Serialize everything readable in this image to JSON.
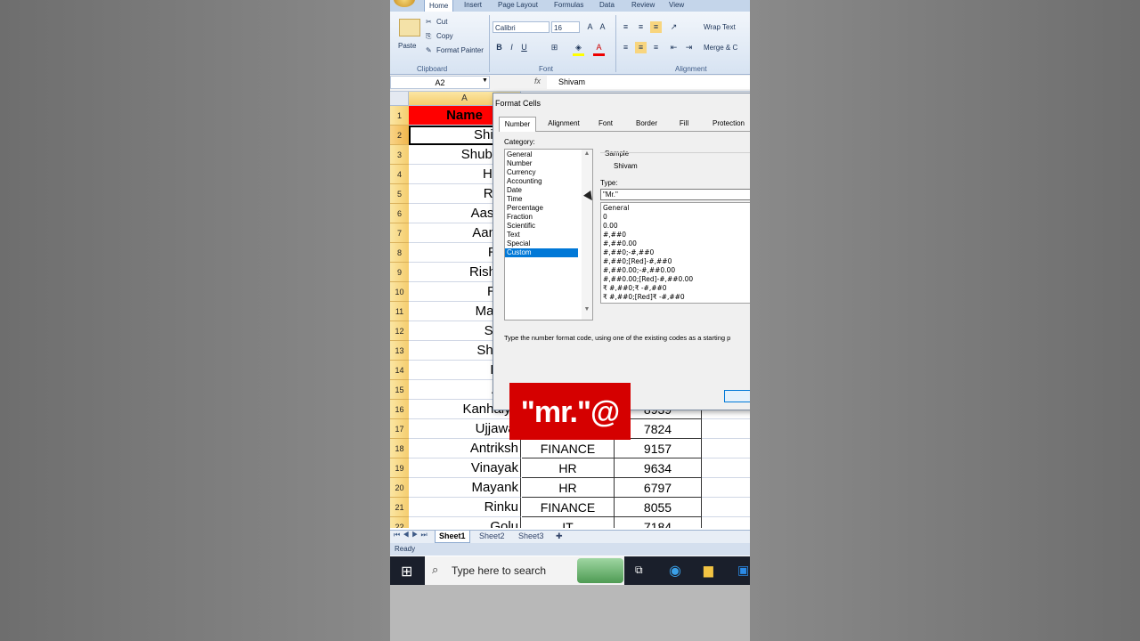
{
  "ribbon": {
    "tabs": [
      "Home",
      "Insert",
      "Page Layout",
      "Formulas",
      "Data",
      "Review",
      "View"
    ],
    "clipboard": {
      "paste": "Paste",
      "cut": "Cut",
      "copy": "Copy",
      "format_painter": "Format Painter",
      "label": "Clipboard"
    },
    "font": {
      "name": "Calibri",
      "size": "16",
      "bold": "B",
      "italic": "I",
      "underline": "U",
      "label": "Font"
    },
    "alignment": {
      "wrap_text": "Wrap Text",
      "merge": "Merge & C",
      "label": "Alignment"
    }
  },
  "formula_bar": {
    "name_box": "A2",
    "fx": "fx",
    "content": "Shivam"
  },
  "columns": [
    "A"
  ],
  "header_cell": "Name",
  "rows": [
    {
      "n": "1"
    },
    {
      "n": "2",
      "a": "Shivam"
    },
    {
      "n": "3",
      "a": "Shubham"
    },
    {
      "n": "4",
      "a": "Harsh"
    },
    {
      "n": "5",
      "a": "Rahul"
    },
    {
      "n": "6",
      "a": "Aashish"
    },
    {
      "n": "7",
      "a": "Aanand"
    },
    {
      "n": "8",
      "a": "Rahil"
    },
    {
      "n": "9",
      "a": "Rishabh"
    },
    {
      "n": "10",
      "a": "Rohit"
    },
    {
      "n": "11",
      "a": "Manish"
    },
    {
      "n": "12",
      "a": "Sumit"
    },
    {
      "n": "13",
      "a": "Shyam"
    },
    {
      "n": "14",
      "a": "Ram"
    },
    {
      "n": "15",
      "a": "Anuj"
    },
    {
      "n": "16",
      "a": "Kanhaiya",
      "b": "",
      "c": "8939"
    },
    {
      "n": "17",
      "a": "Ujjawal",
      "b": "",
      "c": "7824"
    },
    {
      "n": "18",
      "a": "Antriksh",
      "b": "FINANCE",
      "c": "9157"
    },
    {
      "n": "19",
      "a": "Vinayak",
      "b": "HR",
      "c": "9634"
    },
    {
      "n": "20",
      "a": "Mayank",
      "b": "HR",
      "c": "6797"
    },
    {
      "n": "21",
      "a": "Rinku",
      "b": "FINANCE",
      "c": "8055"
    },
    {
      "n": "22",
      "a": "Golu",
      "b": "IT",
      "c": "7184"
    }
  ],
  "sheets": [
    "Sheet1",
    "Sheet2",
    "Sheet3"
  ],
  "status": "Ready",
  "taskbar": {
    "search_placeholder": "Type here to search"
  },
  "dialog": {
    "title": "Format Cells",
    "tabs": [
      "Number",
      "Alignment",
      "Font",
      "Border",
      "Fill",
      "Protection"
    ],
    "category_label": "Category:",
    "categories": [
      "General",
      "Number",
      "Currency",
      "Accounting",
      "Date",
      "Time",
      "Percentage",
      "Fraction",
      "Scientific",
      "Text",
      "Special",
      "Custom"
    ],
    "selected_category": "Custom",
    "sample_label": "Sample",
    "sample_value": "Shivam",
    "type_label": "Type:",
    "type_value": "\"Mr.\"",
    "formats": [
      "General",
      "0",
      "0.00",
      "#,##0",
      "#,##0.00",
      "#,##0;-#,##0",
      "#,##0;[Red]-#,##0",
      "#,##0.00;-#,##0.00",
      "#,##0.00;[Red]-#,##0.00",
      "₹ #,##0;₹ -#,##0",
      "₹ #,##0;[Red]₹ -#,##0"
    ],
    "hint": "Type the number format code, using one of the existing codes as a starting p"
  },
  "overlay_text": "\"mr.\"@"
}
